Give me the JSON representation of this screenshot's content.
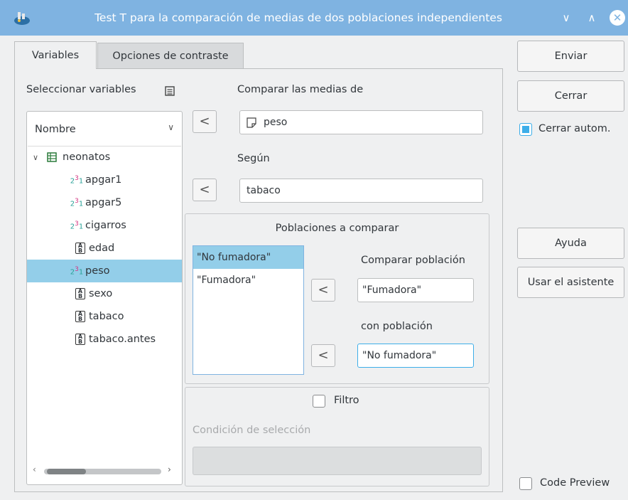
{
  "window": {
    "title": "Test T para la comparación de medias de dos poblaciones independientes",
    "controls": {
      "minimize": "∨",
      "maximize": "∧",
      "close": "✕"
    }
  },
  "tabs": [
    {
      "label": "Variables",
      "active": true
    },
    {
      "label": "Opciones de contraste",
      "active": false
    }
  ],
  "select_vars": {
    "label": "Seleccionar variables",
    "combo_value": "Nombre",
    "dataset": "neonatos",
    "variables": [
      {
        "name": "apgar1",
        "type": "numeric"
      },
      {
        "name": "apgar5",
        "type": "numeric"
      },
      {
        "name": "cigarros",
        "type": "numeric"
      },
      {
        "name": "edad",
        "type": "string"
      },
      {
        "name": "peso",
        "type": "numeric",
        "selected": true
      },
      {
        "name": "sexo",
        "type": "string"
      },
      {
        "name": "tabaco",
        "type": "string"
      },
      {
        "name": "tabaco.antes",
        "type": "string"
      }
    ]
  },
  "compare": {
    "label": "Comparar las medias de",
    "value": "peso",
    "by_label": "Según",
    "by_value": "tabaco",
    "arrow": "<"
  },
  "populations": {
    "title": "Poblaciones a comparar",
    "items": [
      "\"No fumadora\"",
      "\"Fumadora\""
    ],
    "compare_label": "Comparar población",
    "compare_value": "\"Fumadora\"",
    "with_label": "con población",
    "with_value": "\"No fumadora\""
  },
  "filter": {
    "label": "Filtro",
    "checked": false,
    "condition_label": "Condición de selección",
    "condition_value": ""
  },
  "buttons": {
    "send": "Enviar",
    "close": "Cerrar",
    "auto_close": "Cerrar autom.",
    "auto_close_checked": true,
    "help": "Ayuda",
    "wizard": "Usar el asistente",
    "code_preview": "Code Preview",
    "code_preview_checked": false
  },
  "colors": {
    "titlebar": "#7fb3e1",
    "selection": "#93cee9",
    "accent": "#3daee9"
  }
}
